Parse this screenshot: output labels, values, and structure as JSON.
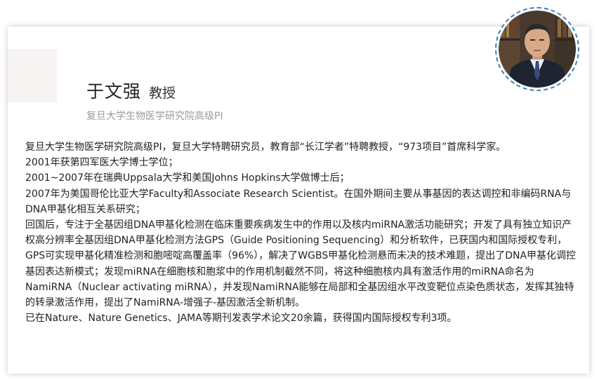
{
  "profile": {
    "name": "于文强",
    "title": "教授",
    "affiliation": "复旦大学生物医学研究院高级PI"
  },
  "bio": [
    "复旦大学生物医学研究院高级PI，复旦大学特聘研究员，教育部“长江学者”特聘教授，“973项目”首席科学家。",
    "2001年获第四军医大学博士学位；",
    "2001~2007年在瑞典Uppsala大学和美国Johns Hopkins大学做博士后；",
    "2007年为美国哥伦比亚大学Faculty和Associate Research Scientist。在国外期间主要从事基因的表达调控和非编码RNA与DNA甲基化相互关系研究；",
    "回国后，专注于全基因组DNA甲基化检测在临床重要疾病发生中的作用以及核内miRNA激活功能研究；开发了具有独立知识产权高分辨率全基因组DNA甲基化检测方法GPS（Guide Positioning Sequencing）和分析软件，已获国内和国际授权专利，GPS可实现甲基化精准检测和胞嘧啶高覆盖率（96%），解决了WGBS甲基化检测悬而未决的技术难题，提出了DNA甲基化调控基因表达新模式；发现miRNA在细胞核和胞浆中的作用机制截然不同，将这种细胞核内具有激活作用的miRNA命名为NamiRNA（Nuclear activating miRNA），并发现NamiRNA能够在局部和全基因组水平改变靶位点染色质状态，发挥其独特的转录激活作用，提出了NamiRNA-增强子-基因激活全新机制。",
    "已在Nature、Nature Genetics、JAMA等期刊发表学术论文20余篇，获得国内国际授权专利3项。"
  ],
  "colors": {
    "avatar_border": "#3b7fc4",
    "affiliation_text": "#9b9b9b",
    "deco_square": "#f8f3f3"
  }
}
